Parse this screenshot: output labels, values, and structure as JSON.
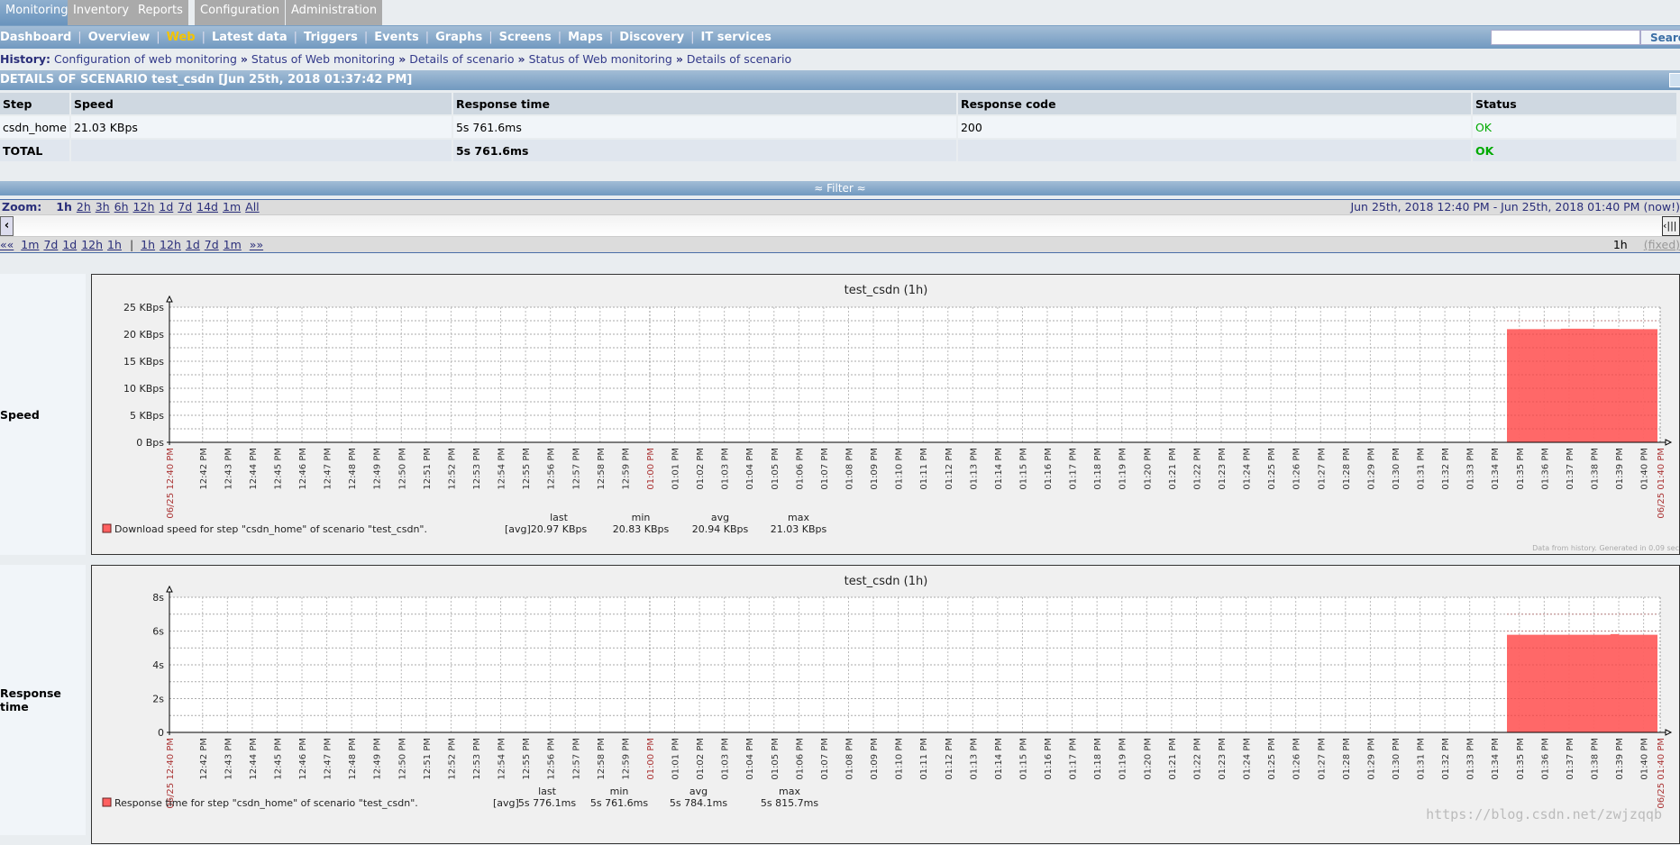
{
  "menu": {
    "tabs": [
      {
        "label": "Monitoring",
        "active": true
      },
      {
        "label": "Inventory"
      },
      {
        "label": "Reports"
      },
      {
        "label": "Configuration"
      },
      {
        "label": "Administration"
      }
    ]
  },
  "submenu": {
    "items": [
      {
        "label": "Dashboard"
      },
      {
        "label": "Overview"
      },
      {
        "label": "Web",
        "active": true
      },
      {
        "label": "Latest data"
      },
      {
        "label": "Triggers"
      },
      {
        "label": "Events"
      },
      {
        "label": "Graphs"
      },
      {
        "label": "Screens"
      },
      {
        "label": "Maps"
      },
      {
        "label": "Discovery"
      },
      {
        "label": "IT services"
      }
    ],
    "search_value": "",
    "search_button": "Search"
  },
  "history": {
    "label": "History:",
    "items": [
      "Configuration of web monitoring",
      "Status of Web monitoring",
      "Details of scenario",
      "Status of Web monitoring",
      "Details of scenario"
    ],
    "sep": "»"
  },
  "details": {
    "title": "DETAILS OF SCENARIO test_csdn [Jun 25th, 2018 01:37:42 PM]",
    "columns": [
      "Step",
      "Speed",
      "Response time",
      "Response code",
      "Status"
    ],
    "rows": [
      [
        "csdn_home",
        "21.03 KBps",
        "5s 761.6ms",
        "200",
        "OK"
      ]
    ],
    "total": [
      "TOTAL",
      "",
      "5s 761.6ms",
      "",
      "OK"
    ]
  },
  "filter": {
    "label": "≈ Filter ≈"
  },
  "zoom": {
    "label": "Zoom:",
    "options": [
      "1h",
      "2h",
      "3h",
      "6h",
      "12h",
      "1d",
      "7d",
      "14d",
      "1m",
      "All"
    ],
    "active": "1h",
    "period": "Jun 25th, 2018 12:40 PM  -  Jun 25th, 2018 01:40 PM (now!)",
    "back": "««",
    "back_links": [
      "1m",
      "7d",
      "1d",
      "12h",
      "1h"
    ],
    "sep": "|",
    "fwd_links": [
      "1h",
      "12h",
      "1d",
      "7d",
      "1m"
    ],
    "fwd": "»»",
    "current": "1h",
    "fixed": "(fixed)"
  },
  "colors": {
    "series": "#ff6060",
    "accent": "#7199c0",
    "ok": "#00aa00",
    "date_label": "#aa3333"
  },
  "chart_data": [
    {
      "type": "area",
      "title": "test_csdn (1h)",
      "row_label": "Speed",
      "ylim": [
        0,
        25
      ],
      "yticks": [
        "0 Bps",
        "5 KBps",
        "10 KBps",
        "15 KBps",
        "20 KBps",
        "25 KBps"
      ],
      "y_unit": "KBps",
      "x_start": "06/25 12:40 PM",
      "x_end": "06/25 01:40 PM",
      "x": [
        "01:34:30",
        "01:35",
        "01:36",
        "01:36:40",
        "01:37",
        "01:38",
        "01:39",
        "01:40"
      ],
      "series": [
        {
          "name": "Download speed for step \"csdn_home\" of scenario \"test_csdn\".",
          "values": [
            20.94,
            20.94,
            20.94,
            21.03,
            21.03,
            20.97,
            20.94,
            20.94
          ]
        }
      ],
      "legend": {
        "func": "[avg]",
        "headers": [
          "last",
          "min",
          "avg",
          "max"
        ],
        "values": [
          "20.97 KBps",
          "20.83 KBps",
          "20.94 KBps",
          "21.03 KBps"
        ]
      },
      "footer": "Data from history. Generated in 0.09 sec"
    },
    {
      "type": "area",
      "title": "test_csdn (1h)",
      "row_label": "Response time",
      "ylim": [
        0,
        8
      ],
      "yticks": [
        "0",
        "2s",
        "4s",
        "6s",
        "8s"
      ],
      "y_unit": "s",
      "x_start": "06/25 12:40 PM",
      "x_end": "06/25 01:40 PM",
      "x": [
        "01:34:30",
        "01:35",
        "01:36",
        "01:37",
        "01:38",
        "01:38:40",
        "01:39",
        "01:40"
      ],
      "series": [
        {
          "name": "Response time for step \"csdn_home\" of scenario \"test_csdn\".",
          "values": [
            5.78,
            5.78,
            5.78,
            5.78,
            5.78,
            5.82,
            5.78,
            5.78
          ]
        }
      ],
      "legend": {
        "func": "[avg]",
        "headers": [
          "last",
          "min",
          "avg",
          "max"
        ],
        "values": [
          "5s 776.1ms",
          "5s 761.6ms",
          "5s 784.1ms",
          "5s 815.7ms"
        ]
      }
    }
  ],
  "watermark": "https://blog.csdn.net/zwjzqqb"
}
